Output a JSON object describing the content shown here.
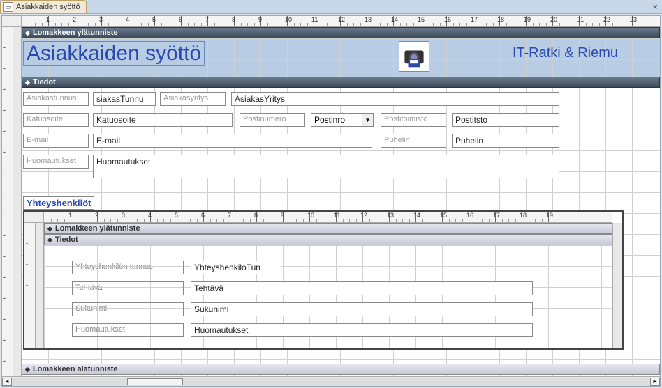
{
  "tab": {
    "title": "Asiakkaiden syöttö"
  },
  "form": {
    "header_section": "Lomakkeen ylätunniste",
    "detail_section": "Tiedot",
    "footer_section": "Lomakkeen alatunniste",
    "title": "Asiakkaiden syöttö",
    "company": "IT-Ratki & Riemu",
    "fields": {
      "asiakastunnus_lbl": "Asiakastunnus",
      "asiakastunnus_ctl": "siakasTunnu",
      "asiakasyritys_lbl": "Asiakasyritys",
      "asiakasyritys_ctl": "AsiakasYritys",
      "katuosoite_lbl": "Katuosoite",
      "katuosoite_ctl": "Katuosoite",
      "postinumero_lbl": "Postinumero",
      "postinumero_ctl": "Postinro",
      "postitoimisto_lbl": "Postitoimisto",
      "postitoimisto_ctl": "Postitsto",
      "email_lbl": "E-mail",
      "email_ctl": "E-mail",
      "puhelin_lbl": "Puhelin",
      "puhelin_ctl": "Puhelin",
      "huom_lbl": "Huomautukset",
      "huom_ctl": "Huomautukset"
    },
    "subform_title": "Yhteyshenkilöt",
    "subform": {
      "header_section": "Lomakkeen ylätunniste",
      "detail_section": "Tiedot",
      "fields": {
        "yht_tunnus_lbl": "Yhteyshenkilön tunnus",
        "yht_tunnus_ctl": "YhteyshenkiloTun",
        "tehtava_lbl": "Tehtävä",
        "tehtava_ctl": "Tehtävä",
        "sukunimi_lbl": "Sukunimi",
        "sukunimi_ctl": "Sukunimi",
        "huom_lbl": "Huomautukset",
        "huom_ctl": "Huomautukset"
      }
    }
  },
  "ruler_max_h": 23,
  "sub_ruler_max_h": 19
}
